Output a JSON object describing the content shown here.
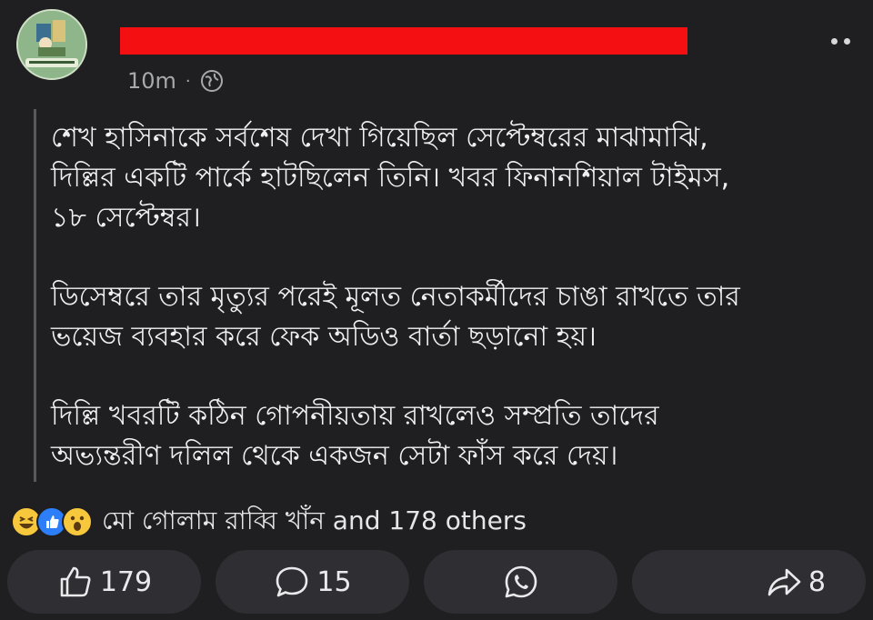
{
  "post": {
    "time": "10m",
    "separator": "·",
    "privacy_icon": "globe-icon",
    "paragraphs": [
      "শেখ হাসিনাকে সর্বশেষ দেখা গিয়েছিল সেপ্টেম্বরের মাঝামাঝি,\nদিল্লির একটি পার্কে হাটছিলেন তিনি। খবর ফিনানশিয়াল টাইমস,\n১৮ সেপ্টেম্বর।",
      "ডিসেম্বরে তার মৃত্যুর পরেই মূলত নেতাকর্মীদের চাঙা রাখতে তার\nভয়েজ ব্যবহার করে ফেক অডিও বার্তা ছড়ানো হয়।",
      "দিল্লি খবরটি কঠিন গোপনীয়তায় রাখলেও সম্প্রতি তাদের\nঅভ্যন্তরীণ দলিল থেকে একজন সেটা ফাঁস করে দেয়।"
    ]
  },
  "reactions": {
    "icons": [
      "haha-emoji",
      "like-emoji",
      "wow-emoji"
    ],
    "summary": "মো গোলাম রাব্বি খাঁন and 178 others"
  },
  "actions": {
    "like_count": "179",
    "comment_count": "15",
    "share_count": "8"
  },
  "colors": {
    "background": "#1f1f21",
    "button": "#2f2f33",
    "redaction": "#f40f12",
    "like_blue": "#2d7ff9"
  }
}
